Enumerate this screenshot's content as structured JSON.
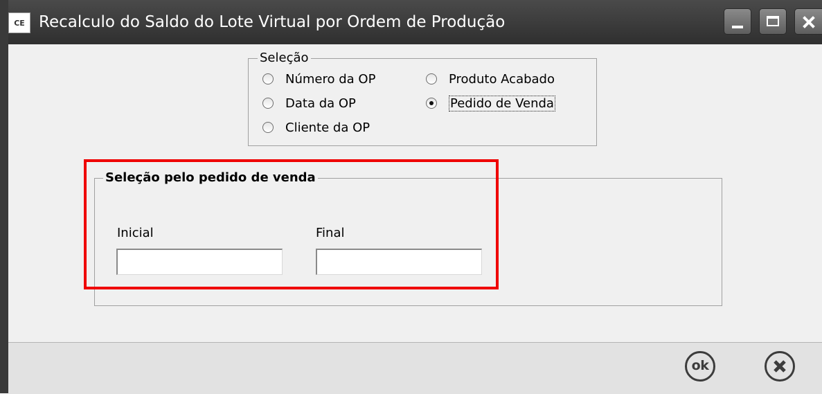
{
  "window": {
    "icon_label": "CE",
    "title": "Recalculo do Saldo do Lote Virtual por Ordem de Produção"
  },
  "selecao": {
    "legend": "Seleção",
    "options": [
      {
        "label": "Número da OP",
        "checked": false
      },
      {
        "label": "Data da OP",
        "checked": false
      },
      {
        "label": "Cliente da OP",
        "checked": false
      },
      {
        "label": "Produto Acabado",
        "checked": false
      },
      {
        "label": "Pedido de Venda",
        "checked": true
      }
    ]
  },
  "pedido": {
    "legend": "Seleção pelo pedido de venda",
    "inicial_label": "Inicial",
    "inicial_value": "",
    "final_label": "Final",
    "final_value": ""
  },
  "footer": {
    "ok_label": "ok"
  },
  "colors": {
    "highlight": "#ef0000",
    "titlebar": "#3a3a3a"
  }
}
